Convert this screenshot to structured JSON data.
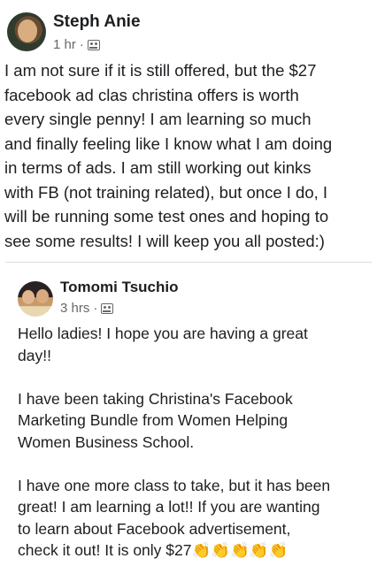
{
  "posts": [
    {
      "author": "Steph Anie",
      "time": "1 hr",
      "separator": "·",
      "audience_icon": "group-icon",
      "text": "I am not sure if it is still offered, but the $27\nfacebook ad clas christina offers is worth\nevery single penny! I am learning so much\nand finally feeling like I know what I am doing\nin terms of ads. I am still working out kinks\nwith FB (not training related), but once I do, I\nwill be running some test ones and hoping to\nsee some results! I will keep you all posted:)"
    },
    {
      "author": "Tomomi Tsuchio",
      "time": "3 hrs",
      "separator": "·",
      "audience_icon": "group-icon",
      "text": "Hello ladies! I hope you are having a great\nday!!\n\nI have been taking Christina's Facebook\nMarketing Bundle from Women Helping\nWomen Business School.\n\nI have one more class to take, but it has been\ngreat! I am learning a lot!! If you are wanting\nto learn about Facebook advertisement,\ncheck it out! It is only $27",
      "emoji": "👏👏👏👏👏"
    }
  ]
}
